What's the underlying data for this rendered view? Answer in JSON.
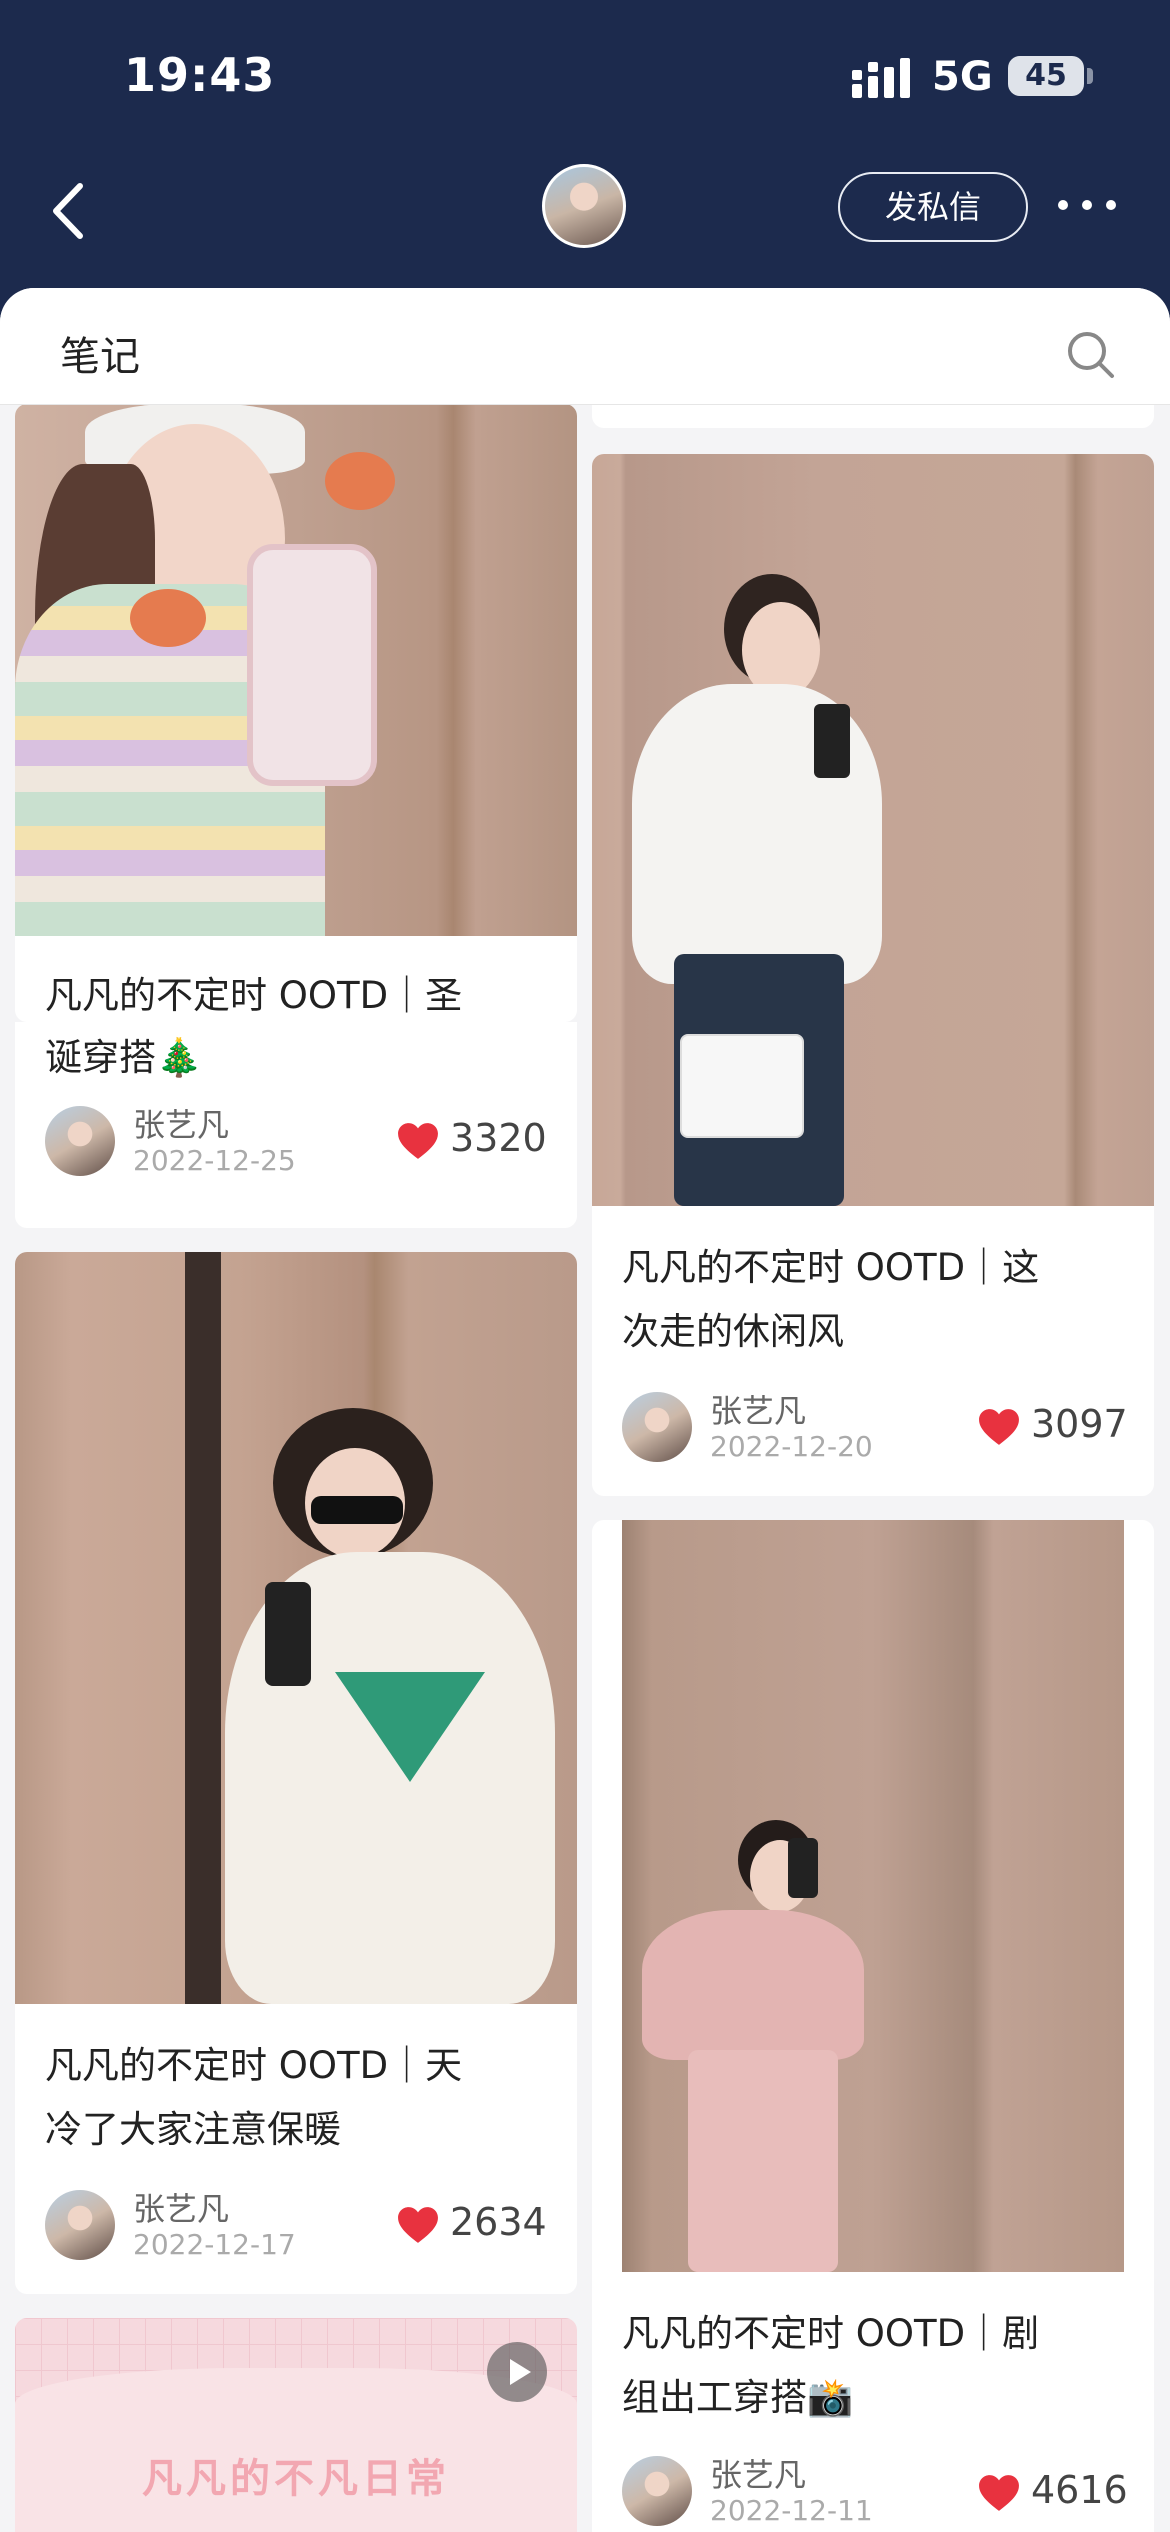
{
  "status": {
    "time": "19:43",
    "network": "5G",
    "battery": "45"
  },
  "nav": {
    "back_icon": "chevron-left-icon",
    "message_button": "发私信",
    "more_icon": "more-dots-icon"
  },
  "section": {
    "title": "笔记",
    "search_icon": "search-icon"
  },
  "notes": [
    {
      "title_line1": "凡凡的不定时 OOTD｜圣",
      "title_line2": "诞穿搭🎄",
      "author": "张艺凡",
      "date": "2022-12-25",
      "likes": "3320"
    },
    {
      "title_line1": "凡凡的不定时 OOTD｜这",
      "title_line2": "次走的休闲风",
      "author": "张艺凡",
      "date": "2022-12-20",
      "likes": "3097"
    },
    {
      "title_line1": "凡凡的不定时 OOTD｜天",
      "title_line2": "冷了大家注意保暖",
      "author": "张艺凡",
      "date": "2022-12-17",
      "likes": "2634"
    },
    {
      "title_line1": "凡凡的不定时 OOTD｜剧",
      "title_line2": "组出工穿搭📸",
      "author": "张艺凡",
      "date": "2022-12-11",
      "likes": "4616"
    },
    {
      "cover_text": "凡凡的不凡日常"
    }
  ],
  "colors": {
    "header_bg": "#1c2a4d",
    "like_heart": "#e8323f"
  }
}
